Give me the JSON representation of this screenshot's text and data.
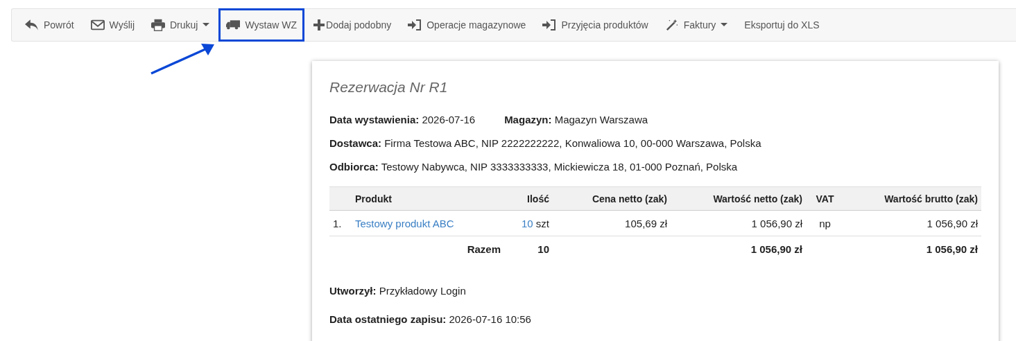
{
  "toolbar": [
    {
      "label": "Powrót",
      "kind": "back",
      "caret": false,
      "highlighted": false
    },
    {
      "label": "Wyślij",
      "kind": "envelope",
      "caret": false,
      "highlighted": false
    },
    {
      "label": "Drukuj",
      "kind": "printer",
      "caret": true,
      "highlighted": false
    },
    {
      "label": "Wystaw WZ",
      "kind": "truck",
      "caret": false,
      "highlighted": true
    },
    {
      "label": "Dodaj podobny",
      "kind": "plus",
      "caret": false,
      "highlighted": false
    },
    {
      "label": "Operacje magazynowe",
      "kind": "signin",
      "caret": false,
      "highlighted": false
    },
    {
      "label": "Przyjęcia produktów",
      "kind": "signin",
      "caret": false,
      "highlighted": false
    },
    {
      "label": "Faktury",
      "kind": "wand",
      "caret": true,
      "highlighted": false
    },
    {
      "label": "Eksportuj do XLS",
      "kind": "text",
      "caret": false,
      "highlighted": false
    }
  ],
  "document": {
    "title": "Rezerwacja Nr R1",
    "header_rows": [
      [
        {
          "label": "Data wystawienia:",
          "value": "2026-07-16"
        },
        {
          "label": "Magazyn:",
          "value": "Magazyn Warszawa"
        }
      ],
      [
        {
          "label": "Dostawca:",
          "value": "Firma Testowa ABC, NIP 2222222222, Konwaliowa 10, 00-000 Warszawa, Polska"
        }
      ],
      [
        {
          "label": "Odbiorca:",
          "value": "Testowy Nabywca, NIP 3333333333, Mickiewicza 18, 01-000 Poznań, Polska"
        }
      ]
    ],
    "table": {
      "columns": [
        "Produkt",
        "Ilość",
        "Cena netto (zak)",
        "Wartość netto (zak)",
        "VAT",
        "Wartość brutto (zak)"
      ],
      "rows": [
        {
          "number": "1.",
          "product": "Testowy produkt ABC",
          "qty": "10",
          "unit": "szt",
          "price": "105,69 zł",
          "net": "1 056,90 zł",
          "vat": "np",
          "gross": "1 056,90 zł"
        }
      ],
      "total": {
        "label": "Razem",
        "qty": "10",
        "net": "1 056,90 zł",
        "gross": "1 056,90 zł"
      }
    },
    "footer_rows": [
      [
        {
          "label": "Utworzył:",
          "value": "Przykładowy Login"
        }
      ],
      [
        {
          "label": "Data ostatniego zapisu:",
          "value": "2026-07-16 10:56"
        }
      ]
    ]
  }
}
